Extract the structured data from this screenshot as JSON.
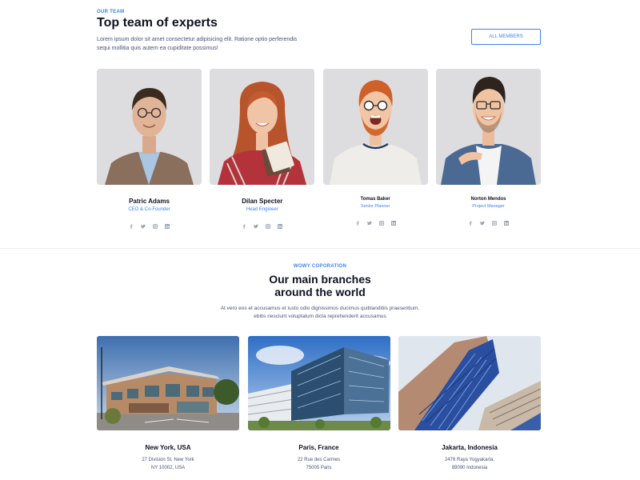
{
  "team": {
    "eyebrow": "OUR TEAM",
    "title": "Top team of experts",
    "description": "Lorem ipsum dolor sit amet consectetur adipisicing elit. Ratione optio perferendis sequi mollitia quis autem ea cupiditate possimus!",
    "all_members_label": "ALL MEMBERS",
    "members": [
      {
        "name": "Patric Adams",
        "role": "CEO & Co-Founder"
      },
      {
        "name": "Dilan Specter",
        "role": "Head Engineer"
      },
      {
        "name": "Tomas Baker",
        "role": "Senior Planner"
      },
      {
        "name": "Norton Mendos",
        "role": "Project Manager"
      }
    ]
  },
  "socials": [
    "facebook-icon",
    "twitter-icon",
    "instagram-icon",
    "linkedin-icon"
  ],
  "branches": {
    "eyebrow": "WOWY COPORATION",
    "title_line1": "Our main branches",
    "title_line2": "around the world",
    "description_line1": "At vero eos et accusamus et iusto odio dignissimos ducimus quiblanditiis praesentium.",
    "description_line2": "ebitis nesciunt voluptatum dicta reprehenderit accusamus",
    "items": [
      {
        "city": "New York, USA",
        "addr1": "27 Division St, New York",
        "addr2": "NY 10002, USA"
      },
      {
        "city": "Paris, France",
        "addr1": "22 Rue des Carmes",
        "addr2": "75005 Paris"
      },
      {
        "city": "Jakarta, Indonesia",
        "addr1": "2476 Raya Yogyakarta,",
        "addr2": "89090 Indonesia"
      }
    ]
  },
  "colors": {
    "accent": "#3b82f6",
    "text": "#0f1222",
    "muted": "#4a5378",
    "icon": "#9aa0b4"
  }
}
